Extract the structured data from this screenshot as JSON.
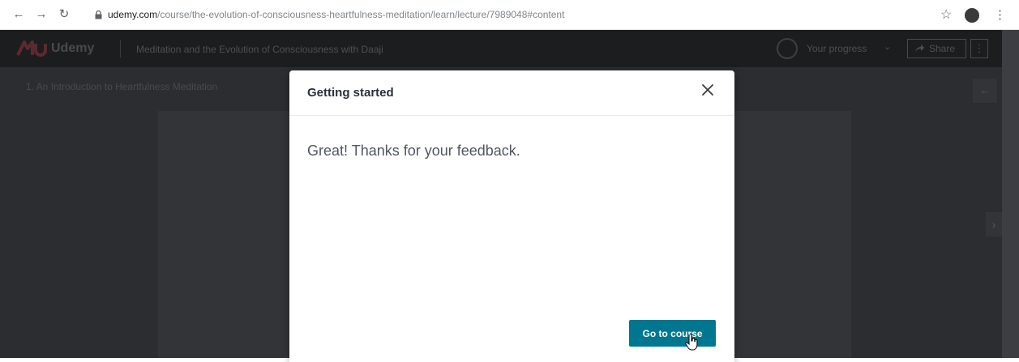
{
  "browser": {
    "url_host": "udemy.com",
    "url_path": "/course/the-evolution-of-consciousness-heartfulness-meditation/learn/lecture/7989048#content",
    "back_icon": "arrow-left-icon",
    "forward_icon": "arrow-right-icon",
    "reload_icon": "reload-icon",
    "lock_icon": "lock-icon",
    "bookmark_icon": "star-icon",
    "menu_icon": "vertical-dots-icon"
  },
  "header": {
    "logo_text": "Udemy",
    "course_title": "Meditation and the Evolution of Consciousness with Daaji",
    "progress_label": "Your progress",
    "share_label": "Share",
    "more_label": "⋮"
  },
  "sidebar": {
    "lecture_title": "1. An Introduction to Heartfulness Meditation",
    "collapse_label": "←",
    "next_label": "›"
  },
  "modal": {
    "title": "Getting started",
    "message": "Great! Thanks for your feedback.",
    "button_label": "Go to course",
    "close_icon": "close-icon"
  },
  "colors": {
    "accent": "#007791",
    "page_dim": "#2b2d31",
    "header_dark": "#1c1d1f",
    "logo_red": "#5c2a2e"
  }
}
